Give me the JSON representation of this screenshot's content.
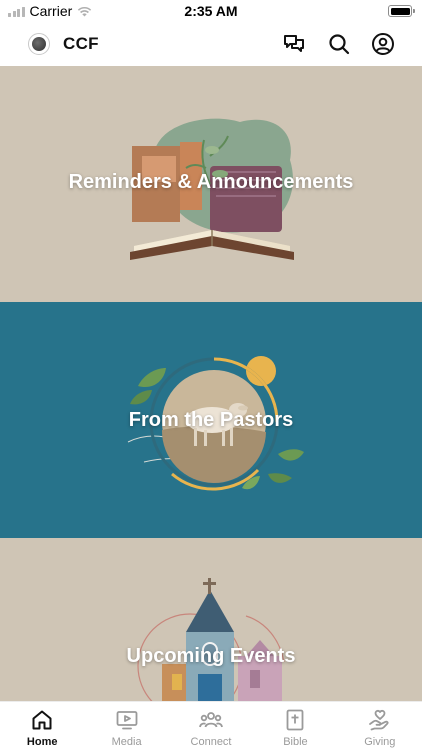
{
  "status_bar": {
    "carrier": "Carrier",
    "time": "2:35 AM"
  },
  "header": {
    "title": "CCF",
    "icons": [
      "chat-icon",
      "search-icon",
      "profile-icon"
    ]
  },
  "banners": [
    {
      "title": "Reminders & Announcements",
      "background": "#cfc5b5"
    },
    {
      "title": "From the Pastors",
      "background": "#27738b"
    },
    {
      "title": "Upcoming Events",
      "background": "#cfc5b5"
    }
  ],
  "tabs": [
    {
      "label": "Home",
      "icon": "home-icon",
      "active": true
    },
    {
      "label": "Media",
      "icon": "media-icon",
      "active": false
    },
    {
      "label": "Connect",
      "icon": "connect-icon",
      "active": false
    },
    {
      "label": "Bible",
      "icon": "bible-icon",
      "active": false
    },
    {
      "label": "Giving",
      "icon": "giving-icon",
      "active": false
    }
  ],
  "colors": {
    "accent": "#111111",
    "inactive": "#9a9a9a",
    "teal": "#27738b",
    "beige": "#cfc5b5"
  }
}
